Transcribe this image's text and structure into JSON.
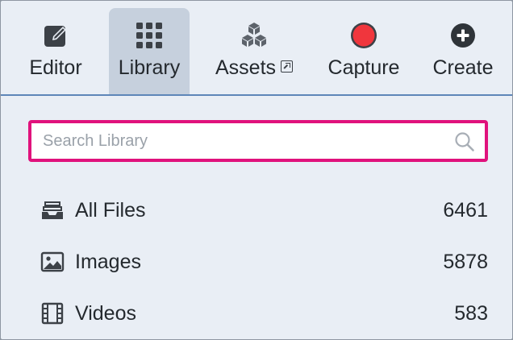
{
  "tabs": [
    {
      "label": "Editor",
      "icon": "edit-icon"
    },
    {
      "label": "Library",
      "icon": "grid-icon"
    },
    {
      "label": "Assets",
      "icon": "cubes-icon",
      "external": "external-link-icon"
    },
    {
      "label": "Capture",
      "icon": "record-icon"
    },
    {
      "label": "Create",
      "icon": "plus-circle-icon"
    }
  ],
  "active_tab": "Library",
  "search": {
    "placeholder": "Search Library",
    "value": ""
  },
  "library_items": [
    {
      "label": "All Files",
      "count": "6461",
      "icon": "inbox-tray-icon"
    },
    {
      "label": "Images",
      "count": "5878",
      "icon": "image-icon"
    },
    {
      "label": "Videos",
      "count": "583",
      "icon": "film-icon"
    }
  ],
  "colors": {
    "background": "#e9eef5",
    "active_tab": "#c6d0dd",
    "accent_line": "#5e86b8",
    "highlight": "#e0127c",
    "record": "#f0363d",
    "text": "#24292e"
  }
}
